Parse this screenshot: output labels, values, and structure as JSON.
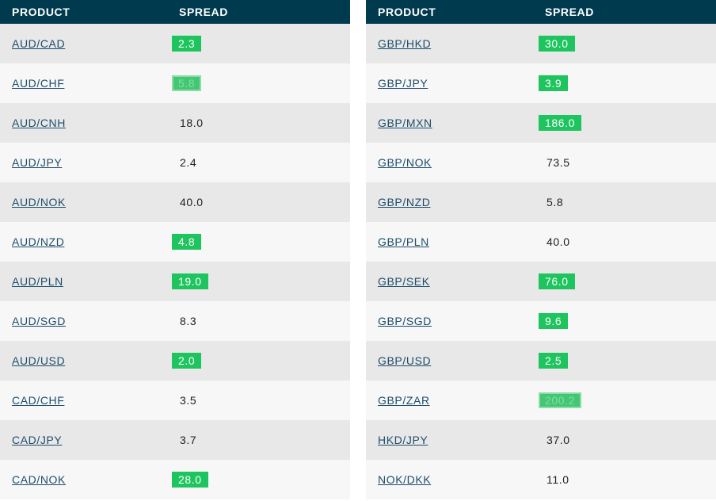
{
  "headers": {
    "product": "PRODUCT",
    "spread": "SPREAD"
  },
  "colors": {
    "header_bg": "#003a4f",
    "highlight": "#1ec55e",
    "link": "#1d4d6b"
  },
  "left": [
    {
      "product": "AUD/CAD",
      "spread": "2.3",
      "highlight": "yes"
    },
    {
      "product": "AUD/CHF",
      "spread": "5.8",
      "highlight": "faint"
    },
    {
      "product": "AUD/CNH",
      "spread": "18.0",
      "highlight": "no"
    },
    {
      "product": "AUD/JPY",
      "spread": "2.4",
      "highlight": "no"
    },
    {
      "product": "AUD/NOK",
      "spread": "40.0",
      "highlight": "no"
    },
    {
      "product": "AUD/NZD",
      "spread": "4.8",
      "highlight": "yes"
    },
    {
      "product": "AUD/PLN",
      "spread": "19.0",
      "highlight": "yes"
    },
    {
      "product": "AUD/SGD",
      "spread": "8.3",
      "highlight": "no"
    },
    {
      "product": "AUD/USD",
      "spread": "2.0",
      "highlight": "yes"
    },
    {
      "product": "CAD/CHF",
      "spread": "3.5",
      "highlight": "no"
    },
    {
      "product": "CAD/JPY",
      "spread": "3.7",
      "highlight": "no"
    },
    {
      "product": "CAD/NOK",
      "spread": "28.0",
      "highlight": "yes"
    }
  ],
  "right": [
    {
      "product": "GBP/HKD",
      "spread": "30.0",
      "highlight": "yes"
    },
    {
      "product": "GBP/JPY",
      "spread": "3.9",
      "highlight": "yes"
    },
    {
      "product": "GBP/MXN",
      "spread": "186.0",
      "highlight": "yes"
    },
    {
      "product": "GBP/NOK",
      "spread": "73.5",
      "highlight": "no"
    },
    {
      "product": "GBP/NZD",
      "spread": "5.8",
      "highlight": "no"
    },
    {
      "product": "GBP/PLN",
      "spread": "40.0",
      "highlight": "no"
    },
    {
      "product": "GBP/SEK",
      "spread": "76.0",
      "highlight": "yes"
    },
    {
      "product": "GBP/SGD",
      "spread": "9.6",
      "highlight": "yes"
    },
    {
      "product": "GBP/USD",
      "spread": "2.5",
      "highlight": "yes"
    },
    {
      "product": "GBP/ZAR",
      "spread": "200.2",
      "highlight": "faint"
    },
    {
      "product": "HKD/JPY",
      "spread": "37.0",
      "highlight": "no"
    },
    {
      "product": "NOK/DKK",
      "spread": "11.0",
      "highlight": "no"
    }
  ]
}
